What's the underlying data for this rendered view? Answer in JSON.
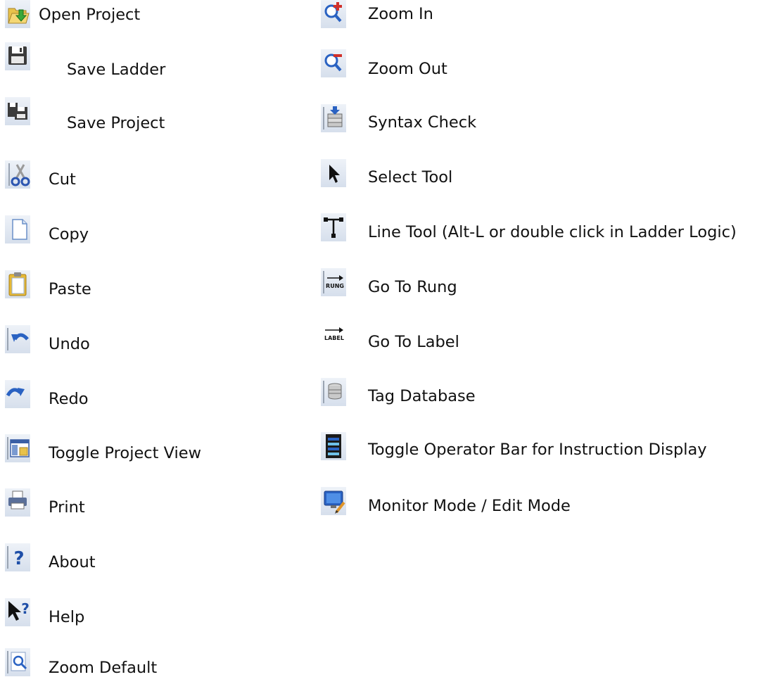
{
  "left": [
    {
      "label": "Open Project",
      "icon": "open-folder-icon"
    },
    {
      "label": "Save Ladder",
      "icon": "floppy-disk-icon"
    },
    {
      "label": "Save Project",
      "icon": "save-all-icon"
    },
    {
      "label": "Cut",
      "icon": "scissors-icon"
    },
    {
      "label": "Copy",
      "icon": "copy-page-icon"
    },
    {
      "label": "Paste",
      "icon": "clipboard-icon"
    },
    {
      "label": "Undo",
      "icon": "undo-arrow-icon"
    },
    {
      "label": "Redo",
      "icon": "redo-arrow-icon"
    },
    {
      "label": "Toggle Project View",
      "icon": "project-view-icon"
    },
    {
      "label": "Print",
      "icon": "printer-icon"
    },
    {
      "label": "About",
      "icon": "question-mark-icon"
    },
    {
      "label": "Help",
      "icon": "help-pointer-icon"
    },
    {
      "label": "Zoom Default",
      "icon": "magnifier-page-icon"
    }
  ],
  "right": [
    {
      "label": "Zoom In",
      "icon": "zoom-in-icon"
    },
    {
      "label": "Zoom Out",
      "icon": "zoom-out-icon"
    },
    {
      "label": "Syntax Check",
      "icon": "syntax-check-icon"
    },
    {
      "label": "Select Tool",
      "icon": "arrow-cursor-icon"
    },
    {
      "label": "Line Tool (Alt-L or double click in Ladder Logic)",
      "icon": "line-tool-icon"
    },
    {
      "label": "Go To Rung",
      "icon": "goto-rung-icon",
      "icon_text": "RUNG"
    },
    {
      "label": "Go To Label",
      "icon": "goto-label-icon",
      "icon_text": "LABEL"
    },
    {
      "label": "Tag Database",
      "icon": "tag-database-icon"
    },
    {
      "label": "Toggle Operator Bar for Instruction Display",
      "icon": "operator-bar-icon"
    },
    {
      "label": "Monitor Mode / Edit Mode",
      "icon": "monitor-mode-icon"
    }
  ]
}
